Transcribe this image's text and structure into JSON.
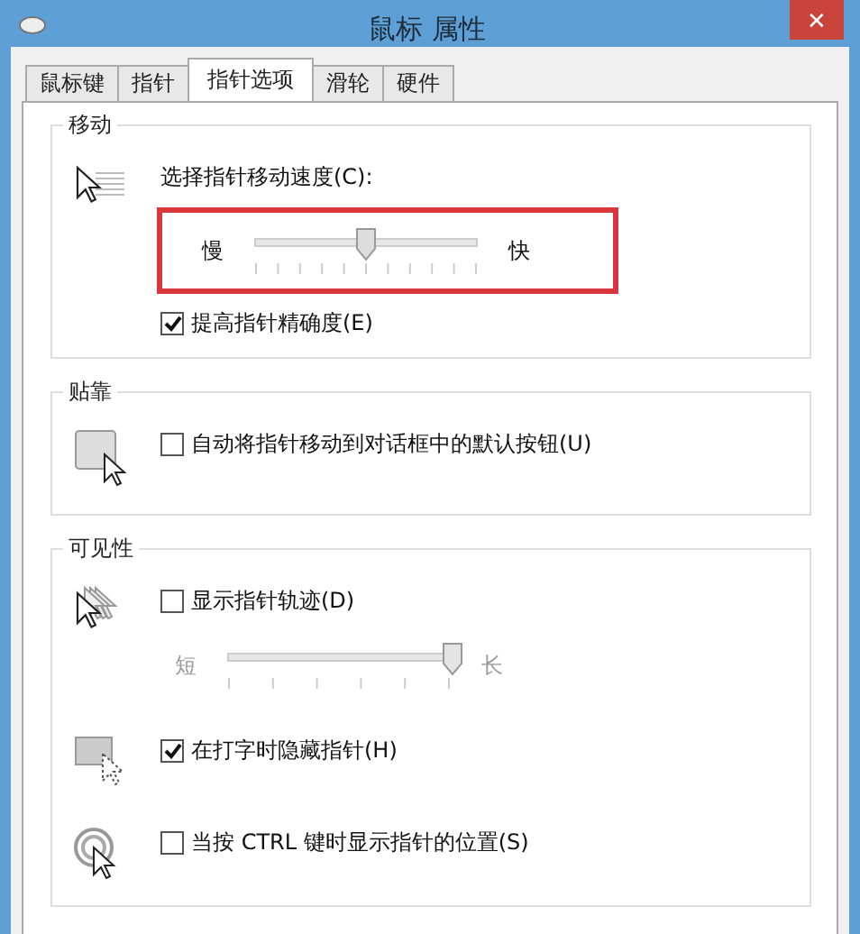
{
  "window": {
    "title": "鼠标 属性",
    "close": "✕"
  },
  "tabs": [
    {
      "label": "鼠标键",
      "selected": false
    },
    {
      "label": "指针",
      "selected": false
    },
    {
      "label": "指针选项",
      "selected": true
    },
    {
      "label": "滑轮",
      "selected": false
    },
    {
      "label": "硬件",
      "selected": false
    }
  ],
  "groups": [
    {
      "title": "移动",
      "rows": [
        {
          "items": [
            {
              "kind": "label",
              "text": "选择指针移动速度(C):"
            },
            {
              "kind": "slider",
              "min_label": "慢",
              "max_label": "快",
              "level": 0.49,
              "disabled": false,
              "highlighted": true
            },
            {
              "kind": "checkbox",
              "label": "提高指针精确度(E)",
              "checked": true
            }
          ]
        }
      ]
    },
    {
      "title": "贴靠",
      "rows": [
        {
          "items": [
            {
              "kind": "checkbox",
              "label": "自动将指针移动到对话框中的默认按钮(U)",
              "checked": false
            }
          ]
        }
      ]
    },
    {
      "title": "可见性",
      "rows": [
        {
          "items": [
            {
              "kind": "checkbox",
              "label": "显示指针轨迹(D)",
              "checked": false
            },
            {
              "kind": "slider",
              "min_label": "短",
              "max_label": "长",
              "level": 1,
              "disabled": true,
              "highlighted": false
            }
          ]
        },
        {
          "items": [
            {
              "kind": "checkbox",
              "label": "在打字时隐藏指针(H)",
              "checked": true
            }
          ]
        },
        {
          "items": [
            {
              "kind": "checkbox",
              "label": "当按 CTRL 键时显示指针的位置(S)",
              "checked": false
            }
          ]
        }
      ]
    }
  ]
}
